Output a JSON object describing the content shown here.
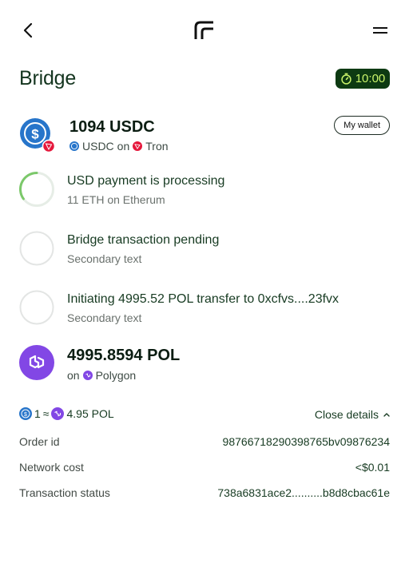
{
  "header": {
    "back_icon": "chevron-left-icon",
    "logo_icon": "brand-logo-icon",
    "menu_icon": "menu-icon"
  },
  "page": {
    "title": "Bridge",
    "timer": "10:00"
  },
  "source": {
    "amount": "1094 USDC",
    "token": "USDC",
    "on_label": "on",
    "network": "Tron",
    "wallet_button": "My wallet"
  },
  "steps": [
    {
      "title": "USD payment is processing",
      "subtitle": "11 ETH on Etherum",
      "status": "in-progress",
      "progress": 0.35
    },
    {
      "title": "Bridge transaction pending",
      "subtitle": "Secondary text",
      "status": "pending"
    },
    {
      "title": "Initiating 4995.52 POL transfer to 0xcfvs....23fvx",
      "subtitle": "Secondary text",
      "status": "pending"
    }
  ],
  "destination": {
    "amount": "4995.8594 POL",
    "on_label": "on",
    "network": "Polygon"
  },
  "rate": {
    "left": "1",
    "approx": "≈",
    "right": "4.95 POL",
    "toggle_label": "Close details"
  },
  "details": [
    {
      "label": "Order id",
      "value": "98766718290398765bv09876234"
    },
    {
      "label": "Network cost",
      "value": "<$0.01"
    },
    {
      "label": "Transaction status",
      "value": "738a6831ace2..........b8d8cbac61e"
    }
  ],
  "colors": {
    "accent_dark": "#0d3a12",
    "accent_lime": "#c9f36a",
    "usdc_blue": "#2775ca",
    "tron_red": "#e5173b",
    "polygon_purple": "#8247e5",
    "progress_green": "#7bc86a"
  }
}
